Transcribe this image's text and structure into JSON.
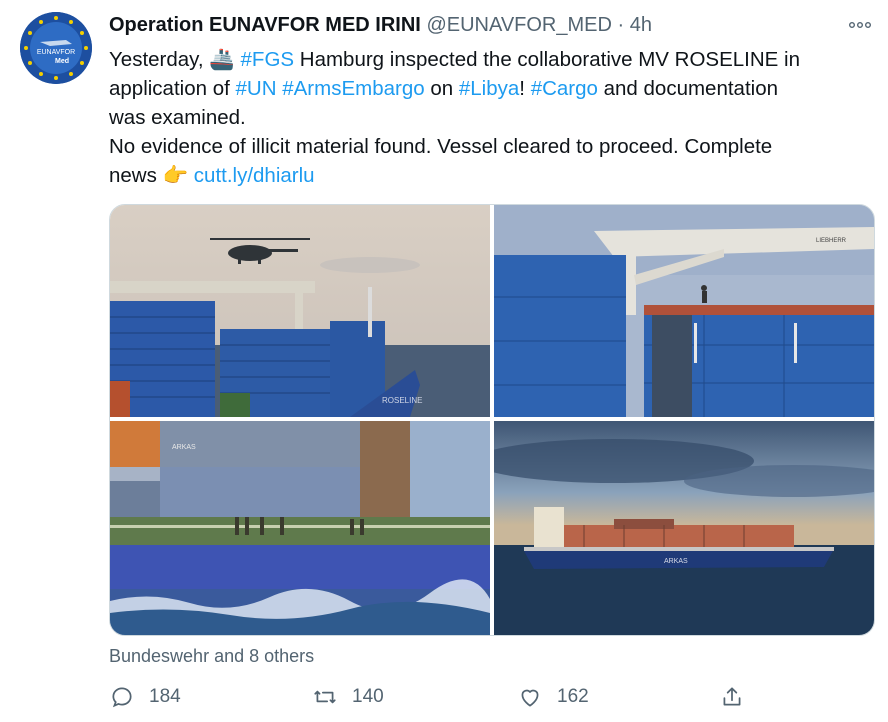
{
  "tweet": {
    "author_name": "Operation EUNAVFOR MED IRINI",
    "handle": "@EUNAVFOR_MED",
    "separator": "·",
    "time": "4h",
    "avatar_text_top": "EUNAVFOR",
    "avatar_text_bottom": "Med",
    "text": {
      "l1_pre": "Yesterday, ",
      "l1_ship_emoji": "🚢",
      "l1_tag1": "#FGS",
      "l1_mid": " Hamburg inspected the collaborative MV ROSELINE in",
      "l2_pre": "application of ",
      "l2_tag_un": "#UN",
      "l2_space": " ",
      "l2_tag_arms": "#ArmsEmbargo",
      "l2_on": " on ",
      "l2_tag_libya": "#Libya",
      "l2_excl": "! ",
      "l2_tag_cargo": "#Cargo",
      "l2_post": " and documentation",
      "l3": "was examined.",
      "l4": "No evidence of illicit material found. Vessel cleared to proceed.  Complete",
      "l5_pre": "news ",
      "l5_emoji": "👉",
      "l5_link": "cutt.ly/dhiarlu"
    },
    "liked_by": "Bundeswehr and 8 others",
    "counts": {
      "replies": "184",
      "retweets": "140",
      "likes": "162"
    },
    "media_labels": {
      "ship_name_1": "ROSELINE",
      "arkas": "ARKAS",
      "liebherr": "LIEBHERR"
    }
  },
  "colors": {
    "link": "#1d9bf0",
    "secondary": "#536471"
  }
}
